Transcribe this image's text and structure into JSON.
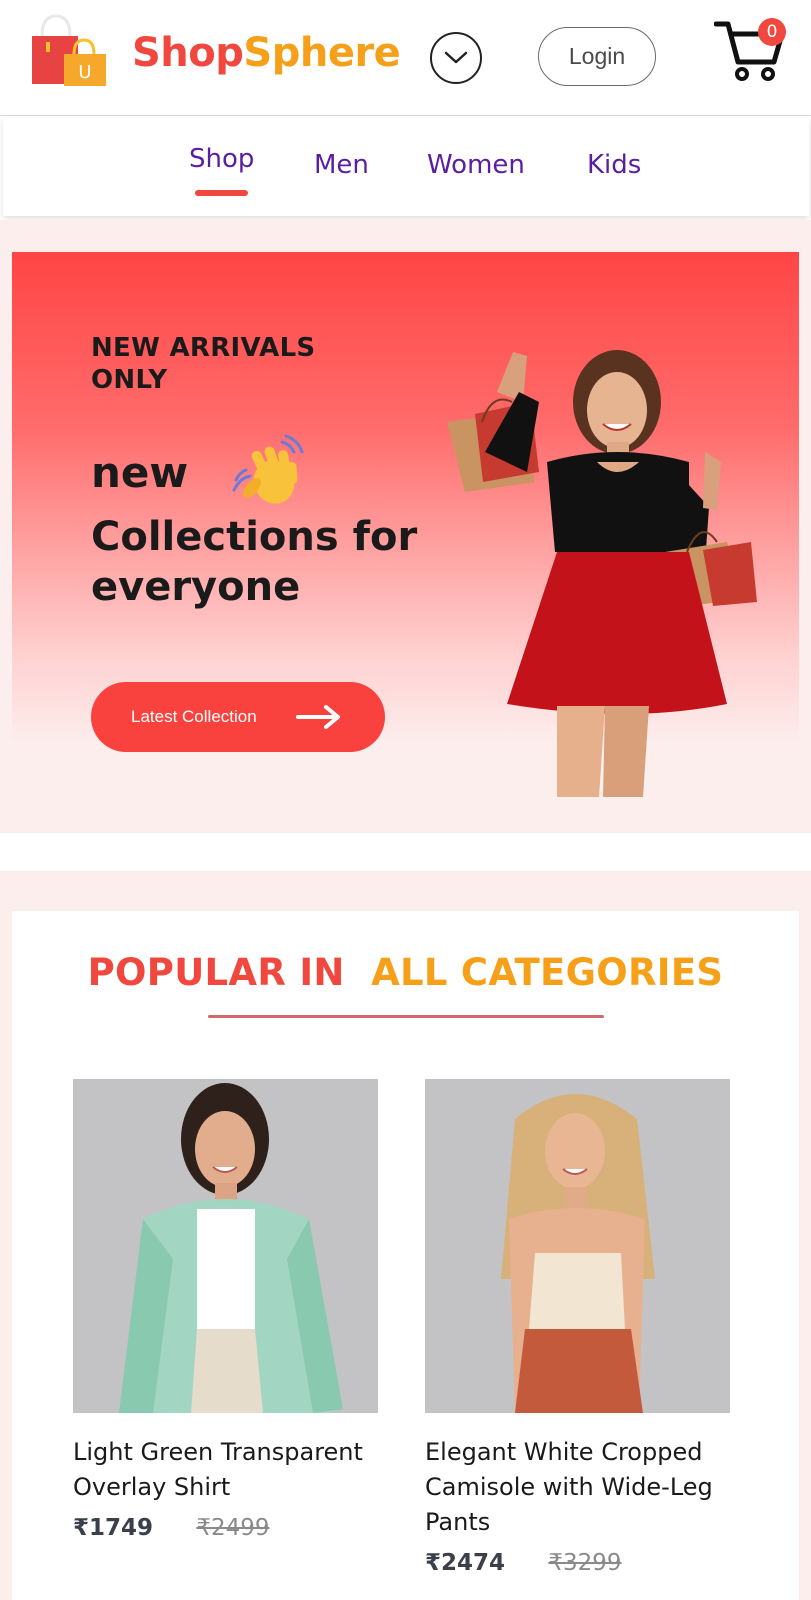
{
  "header": {
    "brand_part1": "Shop",
    "brand_part2": "Sphere",
    "login_label": "Login",
    "cart_count": "0"
  },
  "nav": {
    "items": [
      {
        "label": "Shop",
        "active": true
      },
      {
        "label": "Men"
      },
      {
        "label": "Women"
      },
      {
        "label": "Kids"
      }
    ]
  },
  "hero": {
    "kicker": "NEW ARRIVALS ONLY",
    "line1": "new",
    "line2": "Collections for everyone",
    "cta_label": "Latest Collection"
  },
  "popular": {
    "title_part1": "POPULAR IN",
    "title_part2": "ALL CATEGORIES",
    "products": [
      {
        "name": "Light Green Transparent Overlay Shirt",
        "price": "₹1749",
        "old_price": "₹2499"
      },
      {
        "name": "Elegant White Cropped Camisole with Wide-Leg Pants",
        "price": "₹2474",
        "old_price": "₹3299"
      }
    ]
  },
  "colors": {
    "brand_red": "#f0483e",
    "brand_orange": "#f6a01a",
    "nav_purple": "#5a1fa0"
  },
  "icons": [
    "shopping-bags-logo-icon",
    "chevron-down-icon",
    "cart-icon",
    "waving-hand-icon",
    "arrow-right-icon"
  ]
}
